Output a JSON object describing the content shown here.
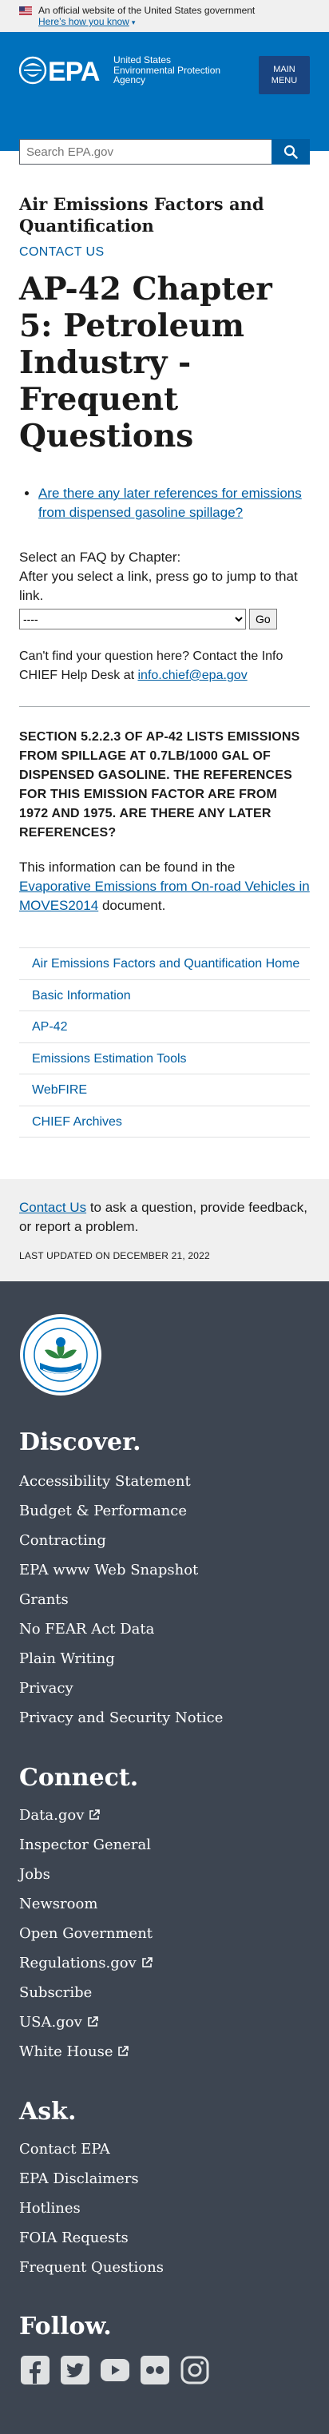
{
  "gov_banner": {
    "official_text": "An official website of the United States government",
    "how_link": "Here’s how you know"
  },
  "header": {
    "logo_text": "EPA",
    "agency_line1": "United States",
    "agency_line2": "Environmental Protection",
    "agency_line3": "Agency",
    "menu_line1": "MAIN",
    "menu_line2": "MENU"
  },
  "search": {
    "placeholder": "Search EPA.gov",
    "icon": "search-icon"
  },
  "main": {
    "section_title": "Air Emissions Factors and Quantification",
    "contact_link": "CONTACT US",
    "page_title": "AP-42 Chapter 5: Petroleum Industry - Frequent Questions",
    "faq_links": [
      "Are there any later references for emissions from dispensed gasoline spillage?"
    ],
    "select_label_1": "Select an FAQ by Chapter:",
    "select_label_2": "After you select a link, press go to jump to that link.",
    "select_value": "----",
    "go_label": "Go",
    "help_prefix": "Can't find your question here?  Contact the Info CHIEF Help Desk at ",
    "help_email": "info.chief@epa.gov",
    "question": "SECTION 5.2.2.3 OF AP-42 LISTS EMISSIONS FROM SPILLAGE AT 0.7LB/1000 GAL OF DISPENSED GASOLINE. THE REFERENCES FOR THIS EMISSION FACTOR ARE FROM 1972 AND 1975. ARE THERE ANY LATER REFERENCES?",
    "answer_prefix": "This information can be found in the ",
    "answer_link": "Evaporative Emissions from On-road Vehicles in MOVES2014",
    "answer_suffix": " document."
  },
  "sidenav": [
    "Air Emissions Factors and Quantification Home",
    "Basic Information",
    "AP-42",
    "Emissions Estimation Tools",
    "WebFIRE",
    "CHIEF Archives"
  ],
  "contact_strip": {
    "link": "Contact Us",
    "text": " to ask a question, provide feedback, or report a problem.",
    "updated": "LAST UPDATED ON DECEMBER 21, 2022"
  },
  "footer": {
    "seal_text": "UNITED STATES · ENVIRONMENTAL PROTECTION AGENCY",
    "discover_title": "Discover.",
    "discover": [
      "Accessibility Statement",
      "Budget & Performance",
      "Contracting",
      "EPA www Web Snapshot",
      "Grants",
      "No FEAR Act Data",
      "Plain Writing",
      "Privacy",
      "Privacy and Security Notice"
    ],
    "connect_title": "Connect.",
    "connect": [
      {
        "label": "Data.gov",
        "external": true
      },
      {
        "label": "Inspector General",
        "external": false
      },
      {
        "label": "Jobs",
        "external": false
      },
      {
        "label": "Newsroom",
        "external": false
      },
      {
        "label": "Open Government",
        "external": false
      },
      {
        "label": "Regulations.gov",
        "external": true
      },
      {
        "label": "Subscribe",
        "external": false
      },
      {
        "label": "USA.gov",
        "external": true
      },
      {
        "label": "White House",
        "external": true
      }
    ],
    "ask_title": "Ask.",
    "ask": [
      "Contact EPA",
      "EPA Disclaimers",
      "Hotlines",
      "FOIA Requests",
      "Frequent Questions"
    ],
    "follow_title": "Follow.",
    "social_icons": [
      "facebook-icon",
      "twitter-icon",
      "youtube-icon",
      "flickr-icon",
      "instagram-icon"
    ]
  },
  "colors": {
    "header_blue": "#0071bc",
    "menu_button": "#1a4480",
    "link_blue": "#005ea2",
    "footer_bg": "#3d4551",
    "banner_bg": "#f0f0f0"
  }
}
